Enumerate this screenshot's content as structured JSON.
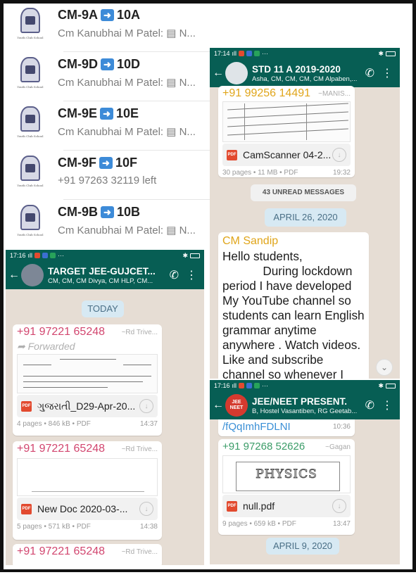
{
  "chat_list": [
    {
      "name_a": "CM-9A",
      "name_b": "10A",
      "preview": "Cm Kanubhai M Patel: ▤ N..."
    },
    {
      "name_a": "CM-9D",
      "name_b": "10D",
      "preview": "Cm Kanubhai M Patel: ▤ N..."
    },
    {
      "name_a": "CM-9E",
      "name_b": "10E",
      "preview": "Cm Kanubhai M Patel: ▤ N..."
    },
    {
      "name_a": "CM-9F",
      "name_b": "10F",
      "preview": "+91 97263 32119 left"
    },
    {
      "name_a": "CM-9B",
      "name_b": "10B",
      "preview": "Cm Kanubhai M Patel: ▤ N..."
    }
  ],
  "logo_caption": "Youth Club School",
  "panel_std": {
    "time": "17:14",
    "title": "STD 11 A 2019-2020",
    "subtitle": "Asha, CM, CM, CM, CM Alpaben,...",
    "sender_top": "+91 99256 14491",
    "sender_top_right": "~MANIS...",
    "doc_name": "CamScanner 04-2...",
    "doc_meta": "30 pages • 11 MB • PDF",
    "doc_time": "19:32",
    "unread": "43 UNREAD MESSAGES",
    "date": "APRIL 26, 2020",
    "sender2": "CM Sandip",
    "message": "Hello students,\n            During lockdown period I have developed My YouTube channel so students can learn English grammar anytime anywhere . Watch videos. Like and subscribe channel so whenever I"
  },
  "panel_jee": {
    "time": "17:16",
    "title": "TARGET JEE-GUJCET...",
    "subtitle": "CM, CM, CM Divya, CM HLP, CM...",
    "today": "TODAY",
    "msg1_sender": "+91 97221 65248",
    "msg1_right": "~Rd Trive...",
    "msg1_forwarded": "Forwarded",
    "msg1_doc": "ગુજરાતી_D29-Apr-20...",
    "msg1_meta": "4 pages • 846 kB • PDF",
    "msg1_time": "14:37",
    "msg2_sender": "+91 97221 65248",
    "msg2_right": "~Rd Trive...",
    "msg2_doc": "New Doc 2020-03-...",
    "msg2_meta": "5 pages • 571 kB • PDF",
    "msg2_time": "14:38",
    "msg3_sender": "+91 97221 65248",
    "msg3_right": "~Rd Trive..."
  },
  "panel_neet": {
    "time": "17:16",
    "title": "JEE/NEET PRESENT.",
    "subtitle": "B, Hostel Vasantiben, RG Geetab...",
    "avatar_text": "JEE NEET",
    "link_text": "/fQqImhFDLNI",
    "link_time": "10:36",
    "sender": "+91 97268 52626",
    "sender_right": "~Gagan",
    "preview_word": "PHYSICS",
    "doc_name": "null.pdf",
    "doc_meta": "9 pages • 659 kB • PDF",
    "doc_time": "13:47",
    "date": "APRIL 9, 2020"
  },
  "colors": {
    "header": "#075e54",
    "sender": "#d2466f",
    "background": "#e6ddd4",
    "date_pill": "#d7e9f3"
  }
}
